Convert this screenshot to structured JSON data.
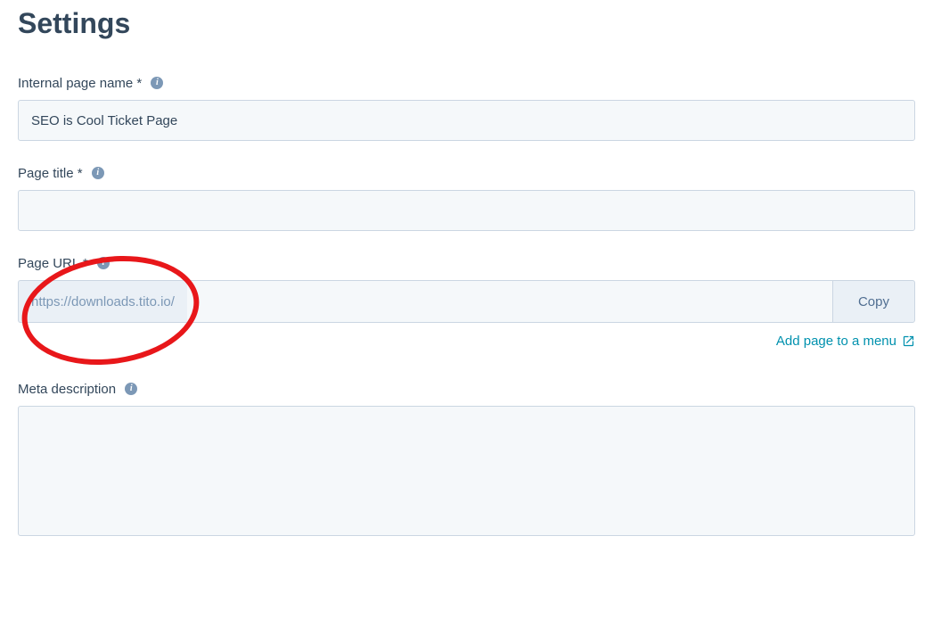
{
  "heading": "Settings",
  "fields": {
    "internalPageName": {
      "label": "Internal page name *",
      "value": "SEO is Cool Ticket Page"
    },
    "pageTitle": {
      "label": "Page title *",
      "value": ""
    },
    "pageUrl": {
      "label": "Page URL *",
      "prefix": "https://downloads.tito.io/",
      "value": "",
      "copyLabel": "Copy"
    },
    "metaDescription": {
      "label": "Meta description",
      "value": ""
    }
  },
  "addPageLink": "Add page to a menu"
}
